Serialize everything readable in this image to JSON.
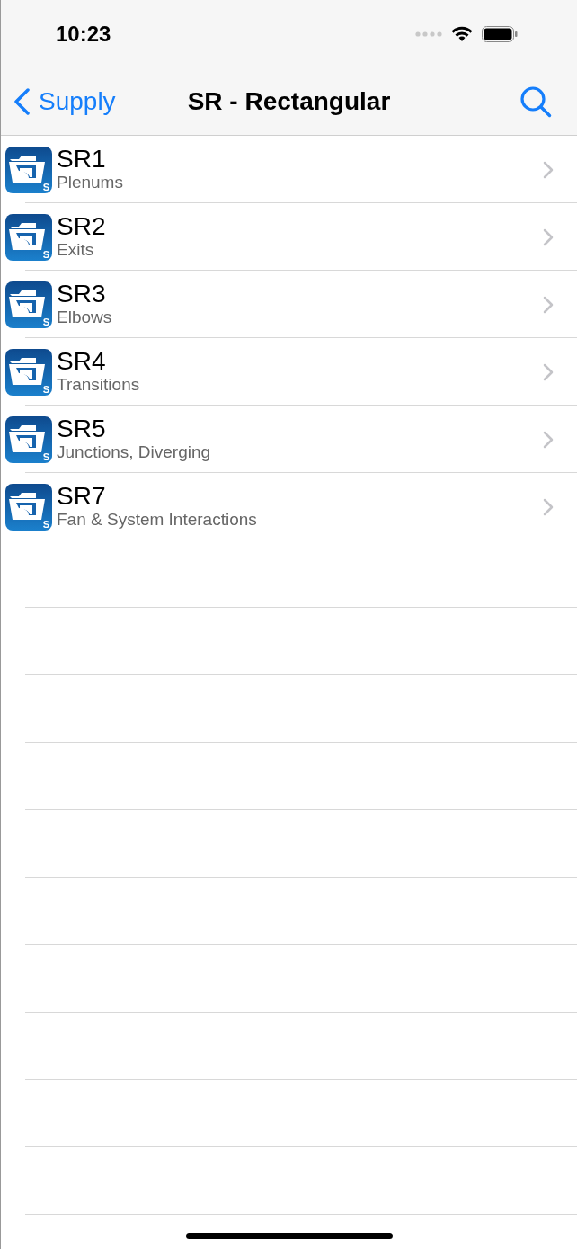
{
  "status_bar": {
    "time": "10:23"
  },
  "nav_bar": {
    "back": "Supply",
    "title": "SR - Rectangular"
  },
  "rows": [
    {
      "title": "SR1",
      "subtitle": "Plenums",
      "badge": "S"
    },
    {
      "title": "SR2",
      "subtitle": "Exits",
      "badge": "S"
    },
    {
      "title": "SR3",
      "subtitle": "Elbows",
      "badge": "S"
    },
    {
      "title": "SR4",
      "subtitle": "Transitions",
      "badge": "S"
    },
    {
      "title": "SR5",
      "subtitle": "Junctions, Diverging",
      "badge": "S"
    },
    {
      "title": "SR7",
      "subtitle": "Fan & System Interactions",
      "badge": "S"
    }
  ]
}
